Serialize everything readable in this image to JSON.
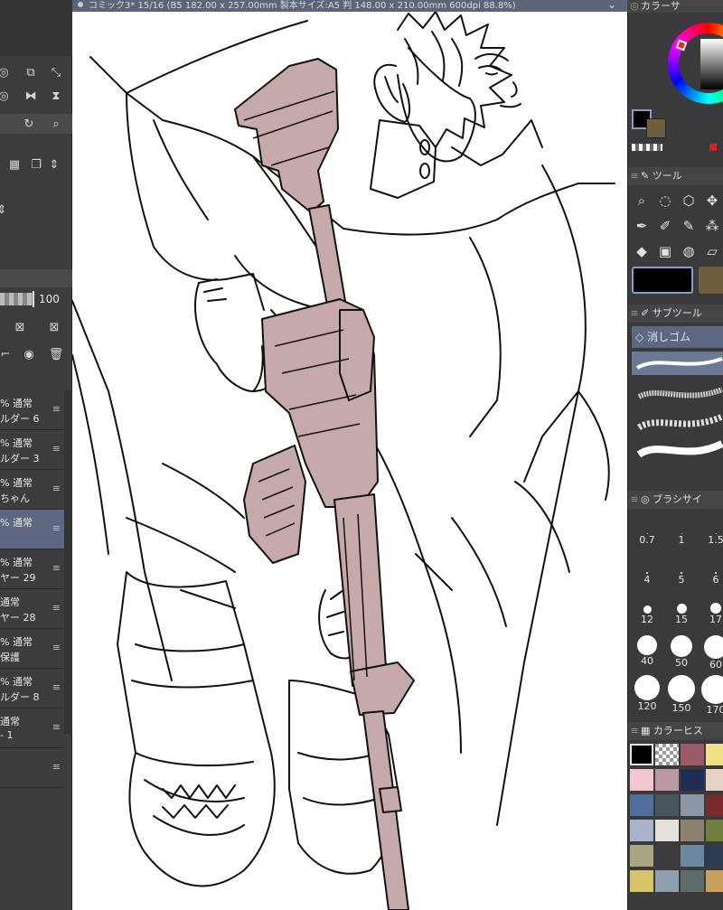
{
  "title": {
    "doc_info": "コミック3* 15/16 (B5 182.00 x 257.00mm 製本サイズ:A5 判 148.00 x 210.00mm 600dpi 88.8%)"
  },
  "left_panel": {
    "opacity_value": "100",
    "layers": [
      {
        "l1": "% 通常",
        "l2": "ルダー 6",
        "selected": false
      },
      {
        "l1": "% 通常",
        "l2": "ルダー 3",
        "selected": false
      },
      {
        "l1": "% 通常",
        "l2": "ちゃん",
        "selected": false
      },
      {
        "l1": "% 通常",
        "l2": "",
        "selected": true
      },
      {
        "l1": "% 通常",
        "l2": "ヤー 29",
        "selected": false
      },
      {
        "l1": "通常",
        "l2": "ヤー 28",
        "selected": false
      },
      {
        "l1": "% 通常",
        "l2": "保護",
        "selected": false
      },
      {
        "l1": "% 通常",
        "l2": "ルダー 8",
        "selected": false
      },
      {
        "l1": "通常",
        "l2": "- 1",
        "selected": false
      }
    ]
  },
  "right_panel": {
    "color_panel_title": "カラーサ",
    "tool_panel_title": "ツール",
    "subtool_panel_title": "サブツール",
    "subtool_item": "消しゴム",
    "brush_size_panel_title": "ブラシサイ",
    "brush_sizes": [
      "0.7",
      "1",
      "1.5",
      "4",
      "5",
      "6",
      "12",
      "15",
      "17",
      "40",
      "50",
      "60",
      "120",
      "150",
      "170"
    ],
    "color_history_title": "カラーヒス",
    "main_color": "#000000",
    "sub_color": "#6e5e3e",
    "history_colors": [
      "#000000",
      "checker",
      "#9a5a67",
      "#f1e087",
      "#f2c6d0",
      "#b99aa4",
      "#1f2e55",
      "#e8d2c4",
      "#4f6f9a",
      "#4a5560",
      "#8d96a8",
      "#7a2b2b",
      "#a7b4cc",
      "#e6e0dc",
      "#8c8170",
      "#6f7f3d",
      "#a9a584",
      "#3c3c40",
      "#6b88a0",
      "#2d3b52",
      "#d6c46a",
      "#8ea0b0",
      "#5c6c6a",
      "#c8a25a"
    ]
  },
  "canvas": {
    "rifle_color": "#c6a9ab",
    "line_color": "#111111"
  }
}
